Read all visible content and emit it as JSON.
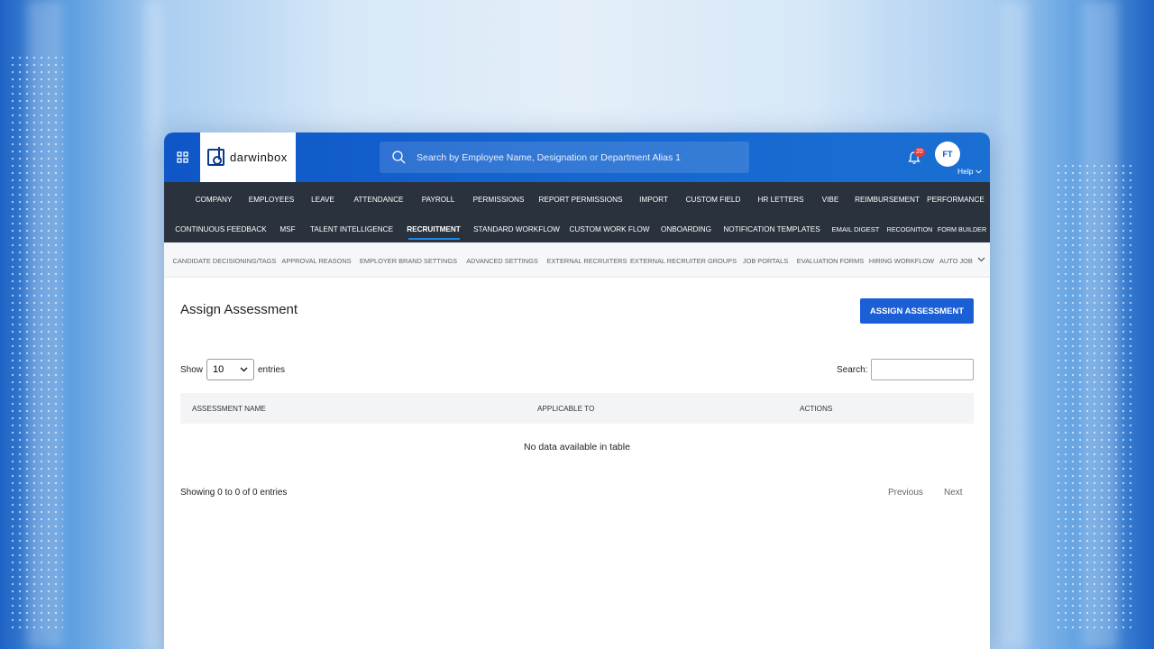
{
  "header": {
    "logo_text": "darwinbox",
    "search_placeholder": "Search by Employee Name, Designation or Department Alias 1",
    "notification_count": "20",
    "avatar_initials": "FT",
    "help_label": "Help"
  },
  "nav": {
    "row1": [
      "COMPANY",
      "EMPLOYEES",
      "LEAVE",
      "ATTENDANCE",
      "PAYROLL",
      "PERMISSIONS",
      "REPORT PERMISSIONS",
      "IMPORT",
      "CUSTOM FIELD",
      "HR LETTERS",
      "VIBE",
      "REIMBURSEMENT",
      "PERFORMANCE"
    ],
    "row2": [
      "CONTINUOUS FEEDBACK",
      "MSF",
      "TALENT INTELLIGENCE",
      "RECRUITMENT",
      "STANDARD WORKFLOW",
      "CUSTOM WORK FLOW",
      "ONBOARDING",
      "NOTIFICATION TEMPLATES",
      "EMAIL DIGEST",
      "RECOGNITION",
      "FORM BUILDER"
    ],
    "active": "RECRUITMENT"
  },
  "subnav": [
    "CANDIDATE DECISIONING/TAGS",
    "APPROVAL REASONS",
    "EMPLOYER BRAND SETTINGS",
    "ADVANCED SETTINGS",
    "EXTERNAL RECRUITERS",
    "EXTERNAL RECRUITER GROUPS",
    "JOB PORTALS",
    "EVALUATION FORMS",
    "HIRING WORKFLOW",
    "AUTO JOB ID"
  ],
  "page": {
    "title": "Assign Assessment",
    "assign_button": "ASSIGN ASSESSMENT",
    "show_label": "Show",
    "page_size": "10",
    "entries_label": "entries",
    "search_label": "Search:",
    "search_value": "",
    "columns": [
      "ASSESSMENT NAME",
      "APPLICABLE TO",
      "ACTIONS"
    ],
    "empty_message": "No data available in table",
    "info": "Showing 0 to 0 of 0 entries",
    "prev_label": "Previous",
    "next_label": "Next"
  },
  "colors": {
    "brand_blue": "#1566cf",
    "nav_dark": "#2a333d",
    "button_blue": "#1a5fd6",
    "badge_red": "#e53935"
  }
}
